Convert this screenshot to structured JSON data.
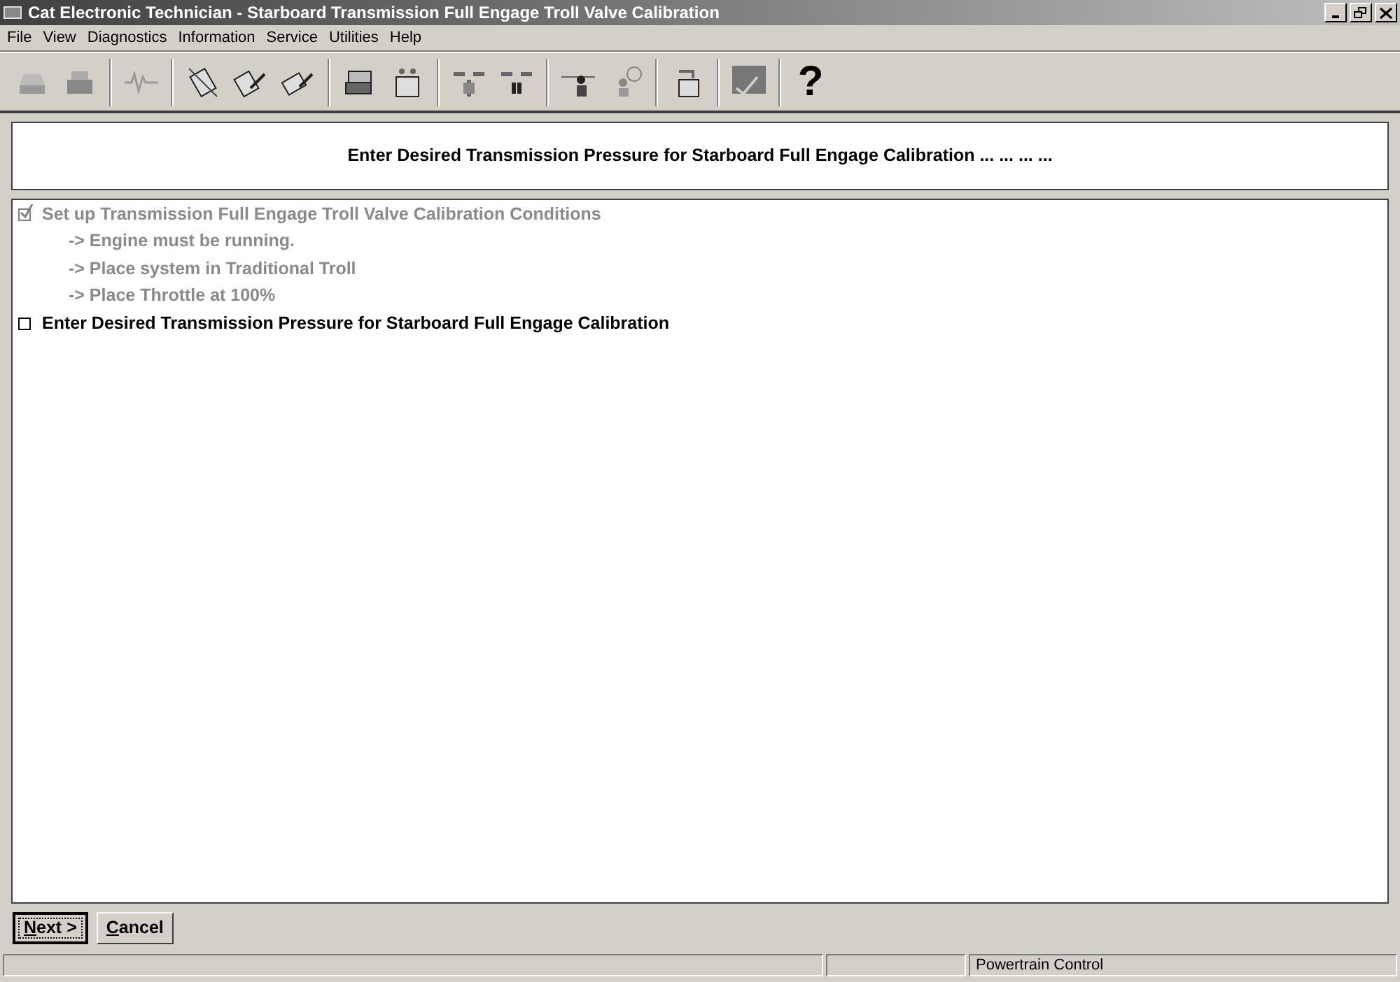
{
  "window": {
    "title": "Cat Electronic Technician - Starboard Transmission Full Engage Troll Valve Calibration"
  },
  "menu": [
    "File",
    "View",
    "Diagnostics",
    "Information",
    "Service",
    "Utilities",
    "Help"
  ],
  "toolbar": {
    "help_label": "?"
  },
  "header": "Enter Desired Transmission Pressure for Starboard Full Engage Calibration ... ... ... ...",
  "steps": [
    {
      "text": "Set up Transmission Full Engage Troll Valve Calibration Conditions",
      "checked": true,
      "done": true,
      "children": [
        "-> Engine must be running.",
        "-> Place system in Traditional Troll",
        "-> Place Throttle at 100%"
      ]
    },
    {
      "text": "Enter Desired Transmission Pressure for Starboard Full Engage Calibration",
      "checked": false,
      "done": false
    }
  ],
  "buttons": [
    {
      "label": "Next >",
      "default": true
    },
    {
      "label": "Cancel",
      "default": false
    }
  ],
  "status_bar": {
    "module": "Powertrain Control"
  }
}
